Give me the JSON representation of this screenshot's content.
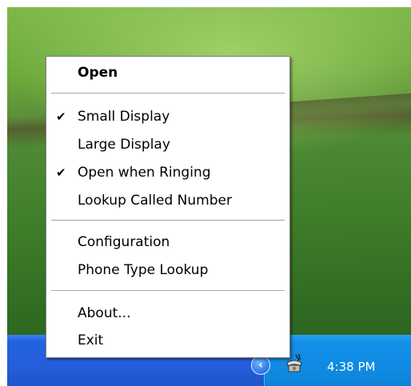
{
  "context_menu": {
    "items": [
      {
        "label": "Open",
        "checked": false,
        "bold": true
      },
      {
        "label": "Small Display",
        "checked": true,
        "bold": false
      },
      {
        "label": "Large Display",
        "checked": false,
        "bold": false
      },
      {
        "label": "Open when Ringing",
        "checked": true,
        "bold": false
      },
      {
        "label": "Lookup Called Number",
        "checked": false,
        "bold": false
      },
      {
        "label": "Configuration",
        "checked": false,
        "bold": false
      },
      {
        "label": "Phone Type Lookup",
        "checked": false,
        "bold": false
      },
      {
        "label": "About...",
        "checked": false,
        "bold": false
      },
      {
        "label": "Exit",
        "checked": false,
        "bold": false
      }
    ],
    "check_glyph": "✔"
  },
  "taskbar": {
    "clock": "4:38 PM",
    "show_hidden_icons_glyph": "‹",
    "colors": {
      "taskbar": "#245edb",
      "tray": "#0f88e0"
    }
  }
}
